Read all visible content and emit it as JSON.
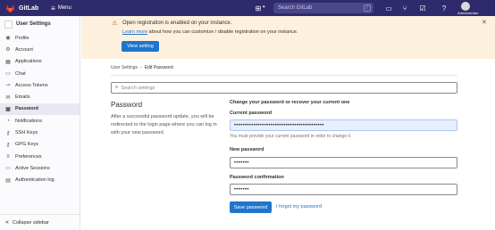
{
  "topbar": {
    "brand": "GitLab",
    "menu_label": "Menu",
    "search_placeholder": "Search GitLab",
    "search_shortcut": "/",
    "user_name": "Administrator"
  },
  "sidebar": {
    "header": "User Settings",
    "items": [
      {
        "label": "Profile",
        "icon": "profile-icon",
        "glyph": "◉"
      },
      {
        "label": "Account",
        "icon": "account-icon",
        "glyph": "⚙"
      },
      {
        "label": "Applications",
        "icon": "applications-icon",
        "glyph": "▦"
      },
      {
        "label": "Chat",
        "icon": "chat-icon",
        "glyph": "▭"
      },
      {
        "label": "Access Tokens",
        "icon": "token-icon",
        "glyph": "⊸"
      },
      {
        "label": "Emails",
        "icon": "mail-icon",
        "glyph": "✉"
      },
      {
        "label": "Password",
        "icon": "lock-icon",
        "glyph": "▣"
      },
      {
        "label": "Notifications",
        "icon": "bell-icon",
        "glyph": "◔"
      },
      {
        "label": "SSH Keys",
        "icon": "key-icon",
        "glyph": "⚷"
      },
      {
        "label": "GPG Keys",
        "icon": "key-icon",
        "glyph": "⚷"
      },
      {
        "label": "Preferences",
        "icon": "preferences-icon",
        "glyph": "≡"
      },
      {
        "label": "Active Sessions",
        "icon": "monitor-icon",
        "glyph": "▭"
      },
      {
        "label": "Authentication log",
        "icon": "log-icon",
        "glyph": "▤"
      }
    ],
    "active_index": 6,
    "collapse_label": "Collapse sidebar"
  },
  "banner": {
    "title": "Open registration is enabled on your instance.",
    "link_text": "Learn more",
    "desc_rest": " about how you can customize / disable registration on your instance.",
    "button_label": "View setting"
  },
  "breadcrumb": {
    "parent": "User Settings",
    "separator": "›",
    "current": "Edit Password"
  },
  "settings_search": {
    "placeholder": "Search settings"
  },
  "password_section": {
    "heading": "Password",
    "description": "After a successful password update, you will be redirected to the login page where you can log in with your new password.",
    "form_title": "Change your password or recover your current one",
    "current_label": "Current password",
    "current_value": "••••••••••••••••••••••••••••••••••••••••••",
    "current_help": "You must provide your current password in order to change it.",
    "new_label": "New password",
    "new_value": "•••••••",
    "confirm_label": "Password confirmation",
    "confirm_value": "•••••••",
    "save_label": "Save password",
    "forgot_label": "I forgot my password"
  },
  "colors": {
    "topbar": "#2f2a6b",
    "accent": "#1f75cb",
    "banner": "#fdf1dd"
  }
}
